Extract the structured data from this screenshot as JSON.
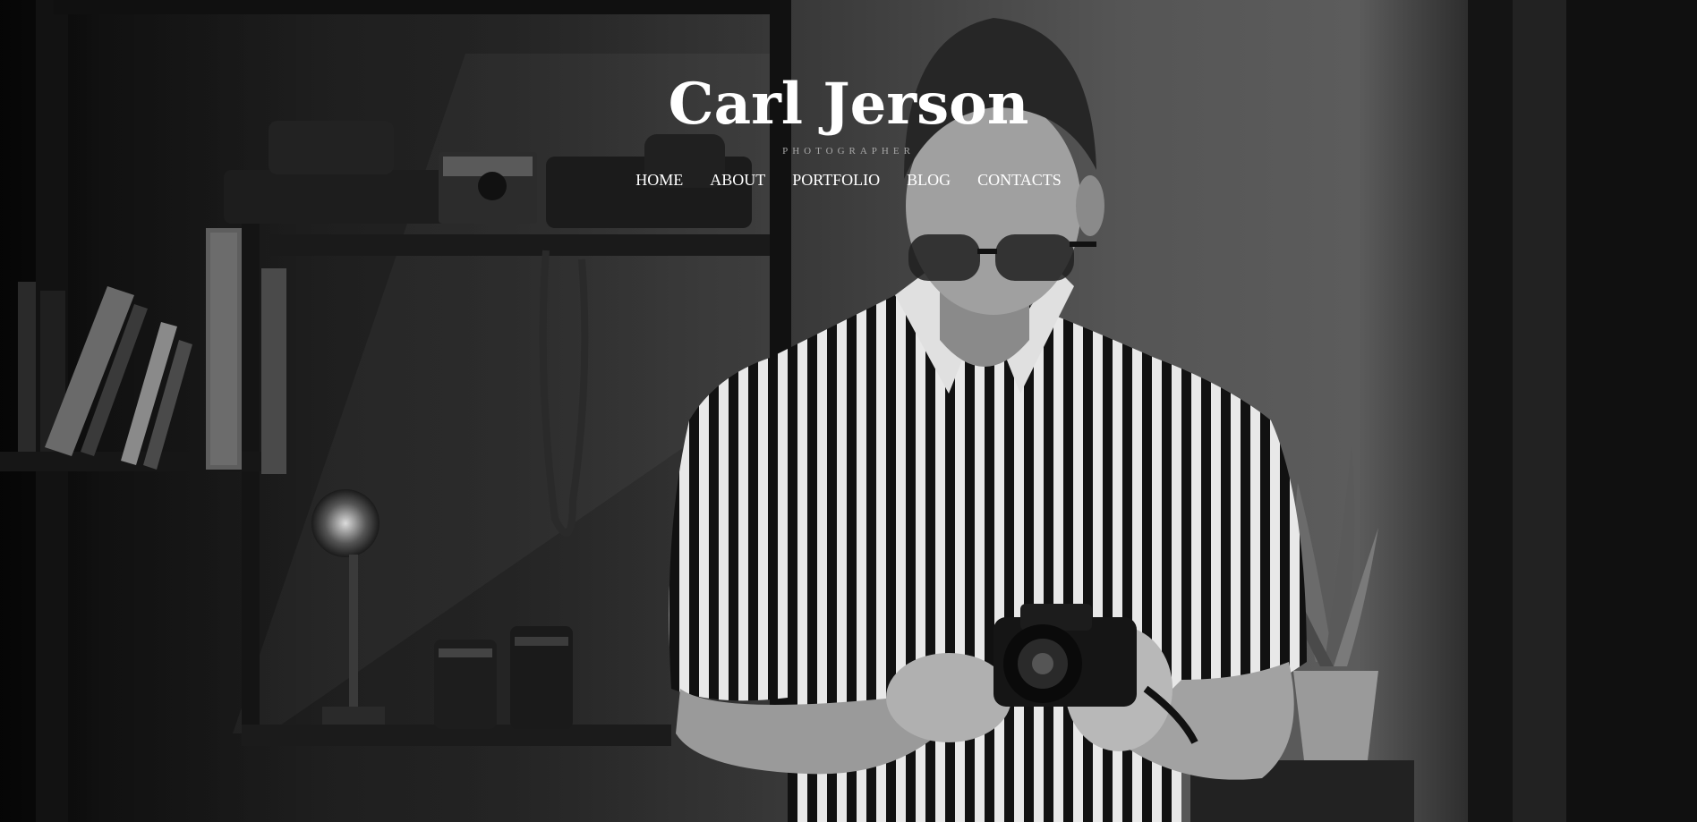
{
  "site": {
    "title": "Carl Jerson",
    "tagline": "PHOTOGRAPHER"
  },
  "nav": {
    "items": [
      {
        "label": "HOME"
      },
      {
        "label": "ABOUT"
      },
      {
        "label": "PORTFOLIO"
      },
      {
        "label": "BLOG"
      },
      {
        "label": "CONTACTS"
      }
    ]
  },
  "hero": {
    "image": "black-and-white photo of a man in a striped shirt holding a camera in front of a shelf"
  },
  "colors": {
    "title": "#ffffff",
    "tagline": "#a8a8a8",
    "nav": "#ffffff",
    "background": "#0b0b0b"
  }
}
